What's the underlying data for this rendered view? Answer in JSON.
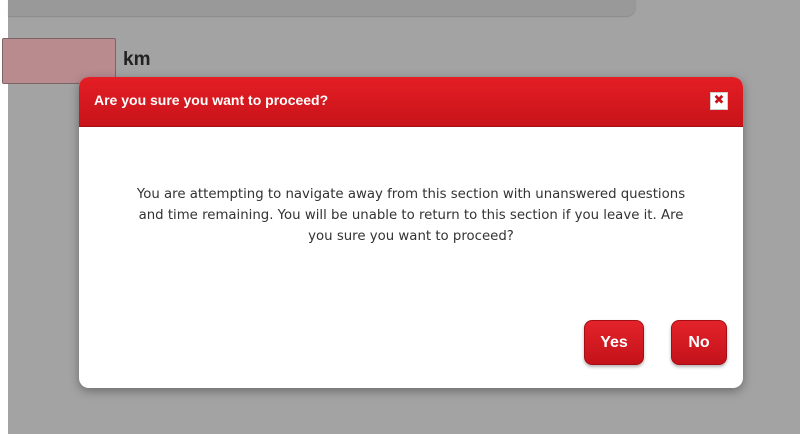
{
  "page": {
    "unit_label": "km"
  },
  "dialog": {
    "title": "Are you sure you want to proceed?",
    "close_symbol": "✖",
    "message": "You are attempting to navigate away from this section with unanswered questions and time remaining. You will be unable to return to this section if you leave it.  Are you sure you want to proceed?",
    "yes_label": "Yes",
    "no_label": "No"
  },
  "colors": {
    "accent_red": "#d4161d",
    "overlay_grey": "#a3a3a3",
    "input_fill": "#b98b8f"
  },
  "icons": {
    "close": "close-icon"
  }
}
